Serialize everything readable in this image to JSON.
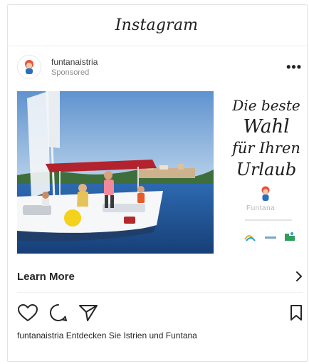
{
  "app": {
    "title": "Instagram"
  },
  "post": {
    "username": "funtanaistria",
    "sponsored": "Sponsored",
    "ad_slogan": [
      "Die beste",
      "Wahl",
      "für Ihren",
      "Urlaub"
    ],
    "logo_text": "Funtana",
    "cta_label": "Learn More",
    "caption_user": "funtanaistria",
    "caption_text": "Entdecken Sie Istrien und Funtana"
  },
  "icons": {
    "like": "heart-outline-icon",
    "comment": "comment-bubble-icon",
    "share": "paper-plane-icon",
    "save": "bookmark-icon",
    "more": "ellipsis-icon",
    "cta": "chevron-right-icon"
  },
  "colors": {
    "text": "#262626",
    "muted": "#8e8e8e",
    "sea": "#1f5fa7",
    "sky": "#8bb3da"
  }
}
